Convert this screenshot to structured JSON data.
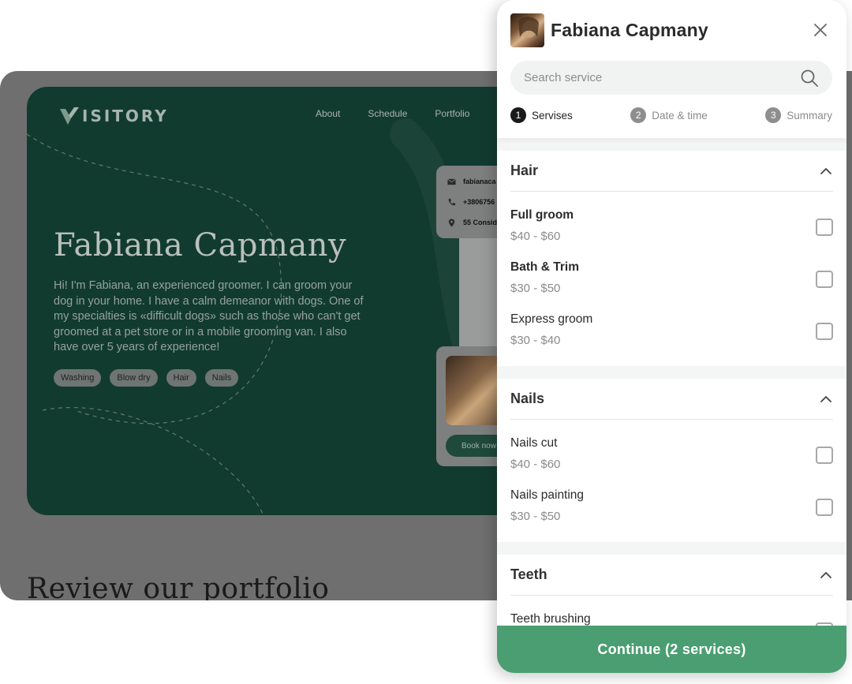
{
  "site": {
    "logo": "ISITORY",
    "nav": [
      "About",
      "Schedule",
      "Portfolio"
    ],
    "hero_name": "Fabiana Capmany",
    "hero_bio": "Hi! I'm Fabiana, an experienced groomer. I can groom your dog in your home. I have a calm demeanor with dogs. One of my specialties is «difficult dogs» such as those who can't get groomed at a pet store or in a mobile grooming van. I also have over 5 years of experience!",
    "tags": [
      "Washing",
      "Blow dry",
      "Hair",
      "Nails"
    ],
    "contact": {
      "email": "fabianaca",
      "phone": "+3806756",
      "address": "55 Consid"
    },
    "book_label": "Book now",
    "portfolio_heading": "Review our portfolio"
  },
  "panel": {
    "name": "Fabiana Capmany",
    "search": {
      "placeholder": "Search service"
    },
    "steps": [
      {
        "num": "1",
        "label": "Servises"
      },
      {
        "num": "2",
        "label": "Date & time"
      },
      {
        "num": "3",
        "label": "Summary"
      }
    ],
    "sections": [
      {
        "title": "Hair",
        "services": [
          {
            "name": "Full groom",
            "price": "$40 - $60"
          },
          {
            "name": "Bath & Trim",
            "price": "$30 - $50"
          },
          {
            "name": "Express groom",
            "price": "$30 - $40"
          }
        ]
      },
      {
        "title": "Nails",
        "services": [
          {
            "name": "Nails cut",
            "price": "$40 - $60"
          },
          {
            "name": "Nails painting",
            "price": "$30 - $50"
          }
        ]
      },
      {
        "title": "Teeth",
        "services": [
          {
            "name": "Teeth brushing",
            "price": ""
          }
        ]
      }
    ],
    "continue_label": "Continue (2 services)"
  },
  "colors": {
    "accent": "#4b9e72",
    "hero_bg": "#123b2f",
    "overlay": "#6f6f6f"
  }
}
